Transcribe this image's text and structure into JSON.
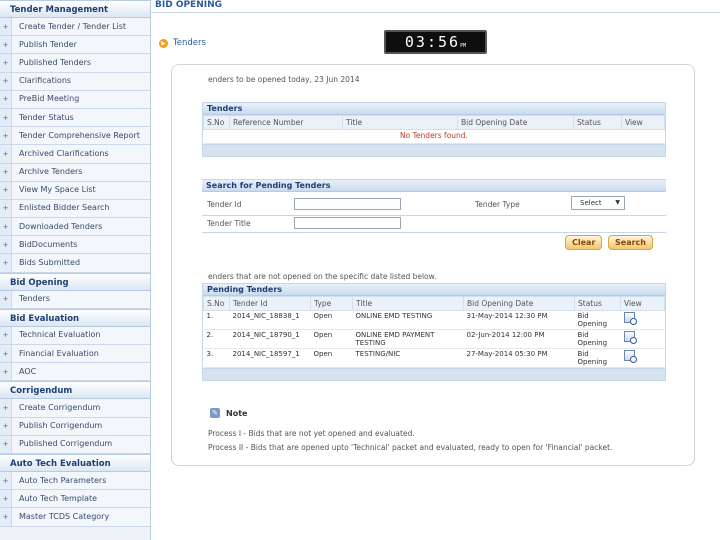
{
  "sidebar": {
    "sections": [
      {
        "title": "Tender Management",
        "items": [
          "Create Tender / Tender List",
          "Publish Tender",
          "Published Tenders",
          "Clarifications",
          "PreBid Meeting",
          "Tender Status",
          "Tender Comprehensive Report",
          "Archived Clarifications",
          "Archive Tenders",
          "View My Space List",
          "Enlisted Bidder Search",
          "Downloaded Tenders",
          "BidDocuments",
          "Bids Submitted"
        ]
      },
      {
        "title": "Bid Opening",
        "items": [
          "Tenders"
        ]
      },
      {
        "title": "Bid Evaluation",
        "items": [
          "Technical Evaluation",
          "Financial Evaluation",
          "AOC"
        ]
      },
      {
        "title": "Corrigendum",
        "items": [
          "Create Corrigendum",
          "Publish Corrigendum",
          "Published Corrigendum"
        ]
      },
      {
        "title": "Auto Tech Evaluation",
        "items": [
          "Auto Tech Parameters",
          "Auto Tech Template",
          "Master TCDS Category"
        ]
      }
    ]
  },
  "header": {
    "title": "BID OPENING",
    "crumb": "Tenders",
    "clock": "03:56",
    "clock_suffix": "PM"
  },
  "today_text": "enders to be opened today, 23 Jun 2014",
  "tenders_box": {
    "title": "Tenders",
    "columns": [
      "S.No",
      "Reference Number",
      "Title",
      "Bid Opening Date",
      "Status",
      "View"
    ],
    "empty_message": "No Tenders found."
  },
  "search_box": {
    "title": "Search for Pending Tenders",
    "tender_id_label": "Tender Id",
    "tender_title_label": "Tender Title",
    "tender_type_label": "Tender Type",
    "tender_type_value": "Select",
    "clear_label": "Clear",
    "search_label": "Search"
  },
  "pending_text": "enders that are not opened on the specific date listed below.",
  "pending_box": {
    "title": "Pending Tenders",
    "columns": [
      "S.No",
      "Tender Id",
      "Type",
      "Title",
      "Bid Opening Date",
      "Status",
      "View"
    ],
    "rows": [
      {
        "sno": "1.",
        "id": "2014_NIC_18838_1",
        "type": "Open",
        "title": "ONLINE EMD TESTING",
        "date": "31-May-2014 12:30 PM",
        "status": "Bid Opening"
      },
      {
        "sno": "2.",
        "id": "2014_NIC_18790_1",
        "type": "Open",
        "title": "ONLINE EMD PAYMENT TESTING",
        "date": "02-Jun-2014 12:00 PM",
        "status": "Bid Opening"
      },
      {
        "sno": "3.",
        "id": "2014_NIC_18597_1",
        "type": "Open",
        "title": "TESTING/NIC",
        "date": "27-May-2014 05:30 PM",
        "status": "Bid Opening"
      }
    ]
  },
  "note": {
    "title": "Note",
    "line1": "Process I - Bids that are not yet opened and evaluated.",
    "line2": "Process II - Bids that are opened upto 'Technical' packet and evaluated, ready to open for 'Financial' packet."
  }
}
